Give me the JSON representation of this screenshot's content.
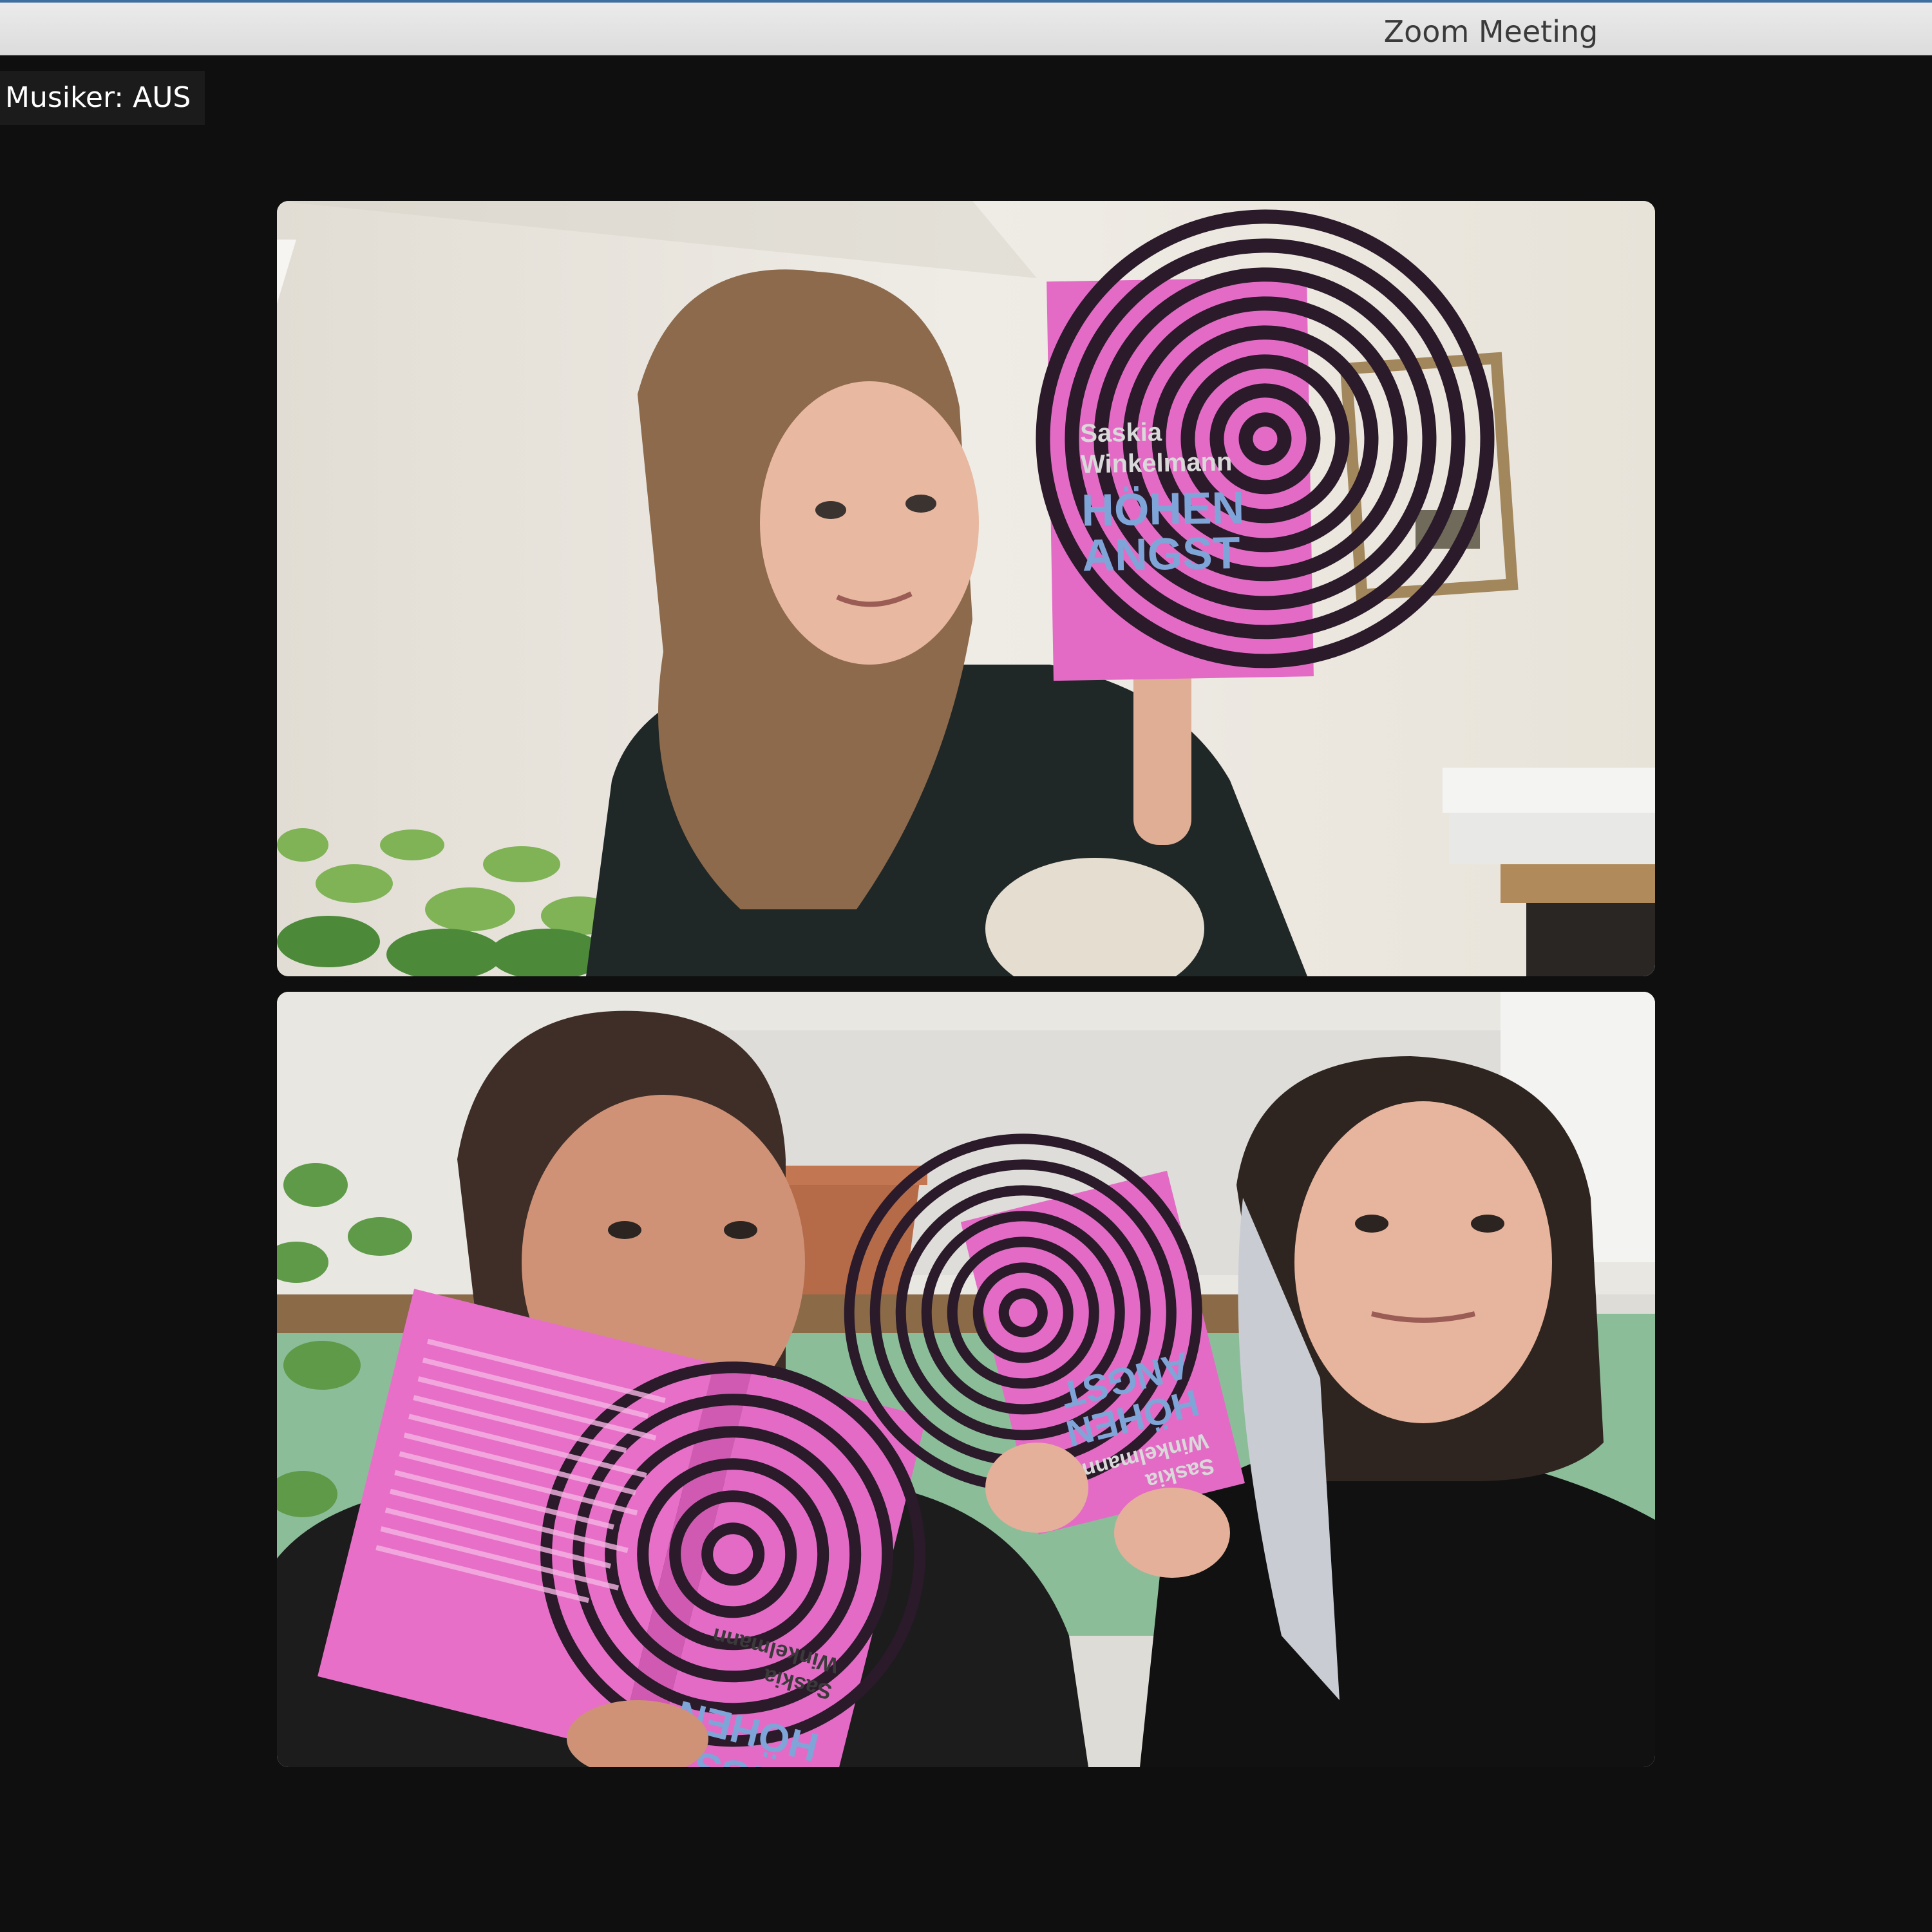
{
  "window": {
    "title": "Zoom Meeting"
  },
  "meeting": {
    "active_speaker_label": "Musiker: AUS"
  },
  "participants": [
    {
      "tile": "top",
      "book": {
        "author_line1": "Saskia",
        "author_line2": "Winkelmann",
        "title_line1": "HÖHEN",
        "title_line2": "ANGST"
      }
    },
    {
      "tile": "bottom",
      "book_left": {
        "author_line1": "Saskia",
        "author_line2": "Winkelmann",
        "title_line1": "HÖHEN",
        "title_line2": "ANGST"
      },
      "book_right": {
        "author_line1": "Saskia",
        "author_line2": "Winkelmann",
        "title_line1": "HÖHEN",
        "title_line2": "ANGST"
      }
    }
  ],
  "colors": {
    "book_pink": "#e36bc6",
    "book_dark": "#2a1a2a",
    "title_blue": "#7fa4d8"
  }
}
